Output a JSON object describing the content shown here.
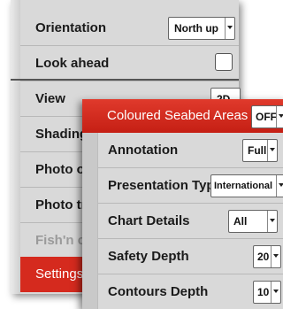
{
  "settings_menu": {
    "items": [
      {
        "label": "Orientation"
      },
      {
        "label": "Look ahead"
      },
      {
        "label": "View"
      },
      {
        "label": "Shading"
      },
      {
        "label": "Photo ov"
      },
      {
        "label": "Photo tr"
      },
      {
        "label": "Fish'n ch"
      },
      {
        "label": "Settings"
      }
    ],
    "orientation_value": "North up",
    "view_value": "2D",
    "look_ahead_checked": false,
    "selected_item": "Settings"
  },
  "chart_settings_submenu": {
    "header": {
      "label": "Coloured Seabed Areas",
      "value": "OFF"
    },
    "rows": [
      {
        "label": "Annotation",
        "value": "Full"
      },
      {
        "label": "Presentation Type",
        "value": "International"
      },
      {
        "label": "Chart Details",
        "value": "All"
      },
      {
        "label": "Safety Depth",
        "value": "20"
      },
      {
        "label": "Contours Depth",
        "value": "10"
      }
    ]
  },
  "colors": {
    "accent_red": "#d52a1e",
    "panel_grey": "#d9d9d9"
  }
}
